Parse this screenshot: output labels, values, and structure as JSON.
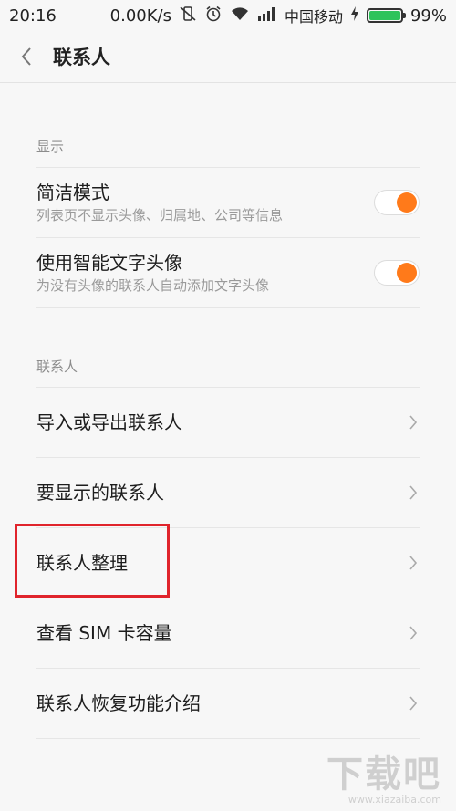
{
  "status_bar": {
    "time": "20:16",
    "speed": "0.00K/s",
    "carrier": "中国移动",
    "battery": "99%"
  },
  "header": {
    "title": "联系人"
  },
  "display_section": {
    "label": "显示",
    "items": [
      {
        "title": "简洁模式",
        "subtitle": "列表页不显示头像、归属地、公司等信息",
        "enabled": true
      },
      {
        "title": "使用智能文字头像",
        "subtitle": "为没有头像的联系人自动添加文字头像",
        "enabled": true
      }
    ]
  },
  "contacts_section": {
    "label": "联系人",
    "items": [
      {
        "title": "导入或导出联系人"
      },
      {
        "title": "要显示的联系人"
      },
      {
        "title": "联系人整理"
      },
      {
        "title": "查看 SIM 卡容量"
      },
      {
        "title": "联系人恢复功能介绍"
      }
    ]
  },
  "watermark": {
    "logo": "下载吧",
    "url": "www.xiazaiba.com"
  },
  "colors": {
    "accent": "#ff7a1a",
    "highlight": "#e0242c",
    "battery": "#2ec35b"
  }
}
